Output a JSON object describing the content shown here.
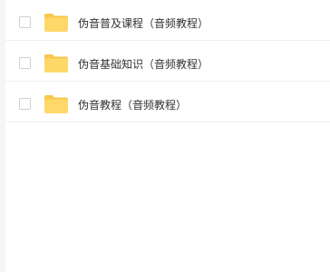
{
  "colors": {
    "folder_back": "#f6c94b",
    "folder_front": "#ffd86a",
    "text": "#333333"
  },
  "files": [
    {
      "name": "伪音普及课程（音频教程）",
      "icon": "folder-icon",
      "checked": false
    },
    {
      "name": "伪音基础知识（音频教程）",
      "icon": "folder-icon",
      "checked": false
    },
    {
      "name": "伪音教程（音频教程）",
      "icon": "folder-icon",
      "checked": false
    }
  ]
}
